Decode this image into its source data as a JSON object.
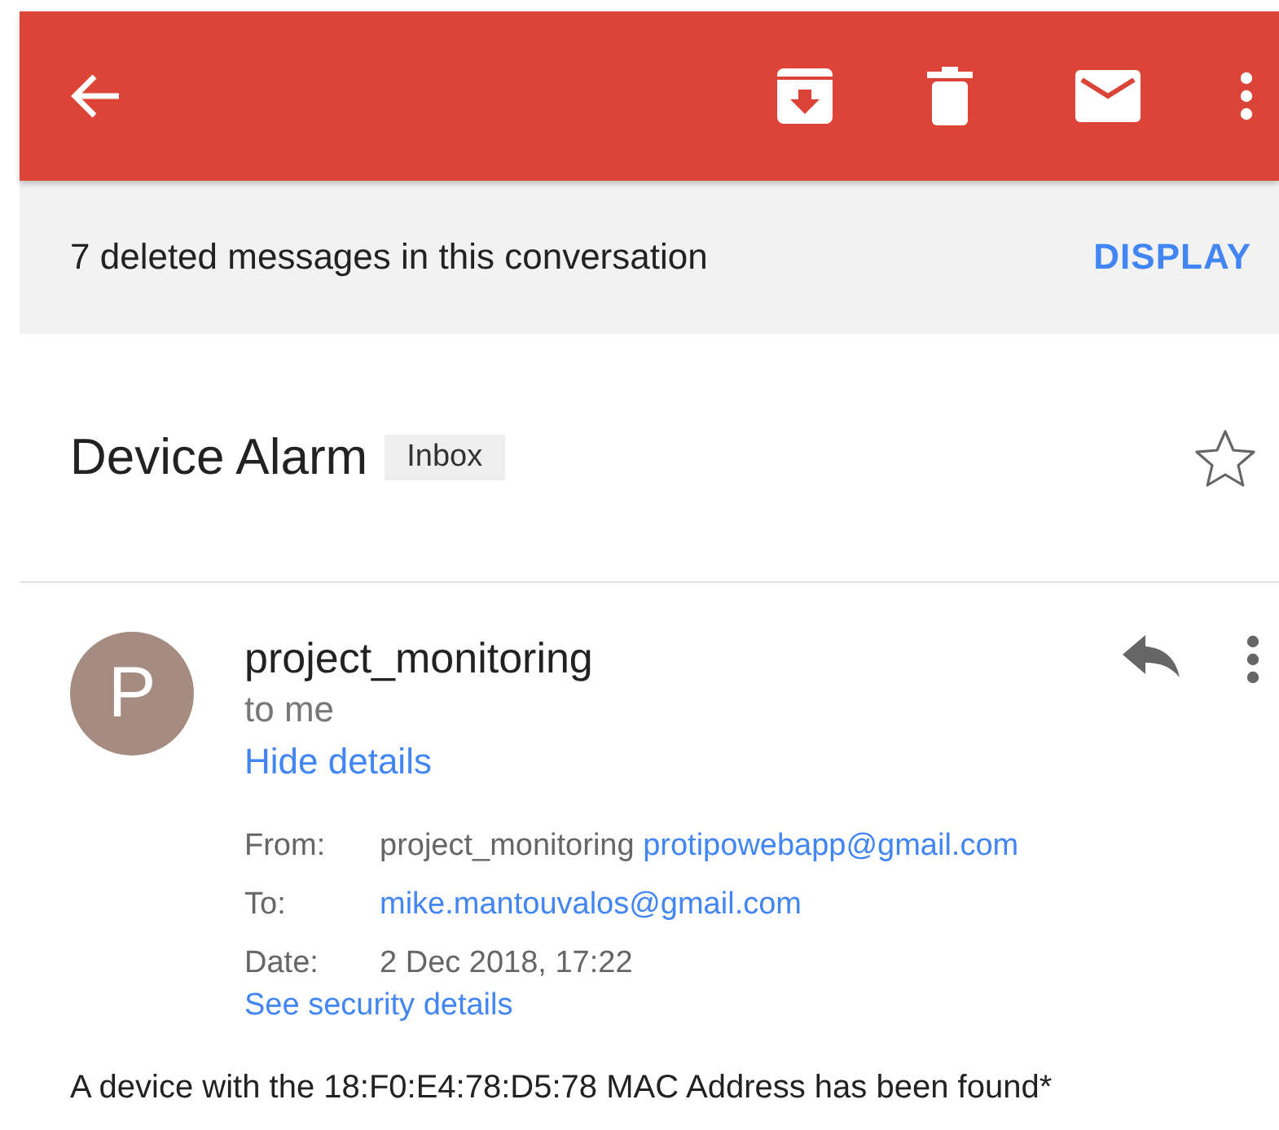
{
  "banner": {
    "text": "7 deleted messages in this conversation",
    "action": "DISPLAY"
  },
  "subject": {
    "title": "Device Alarm",
    "label": "Inbox",
    "starred": false
  },
  "message": {
    "avatar_letter": "P",
    "sender": "project_monitoring",
    "recipients": "to me",
    "toggle": "Hide details",
    "details": [
      {
        "label": "From:",
        "name": "project_monitoring",
        "email": "protipowebapp@gmail.com"
      },
      {
        "label": "To:",
        "email": "mike.mantouvalos@gmail.com"
      },
      {
        "label": "Date:",
        "value": "2 Dec 2018, 17:22"
      }
    ],
    "security_link": "See security details",
    "body": "A device with the 18:F0:E4:78:D5:78 MAC Address has been found*"
  }
}
